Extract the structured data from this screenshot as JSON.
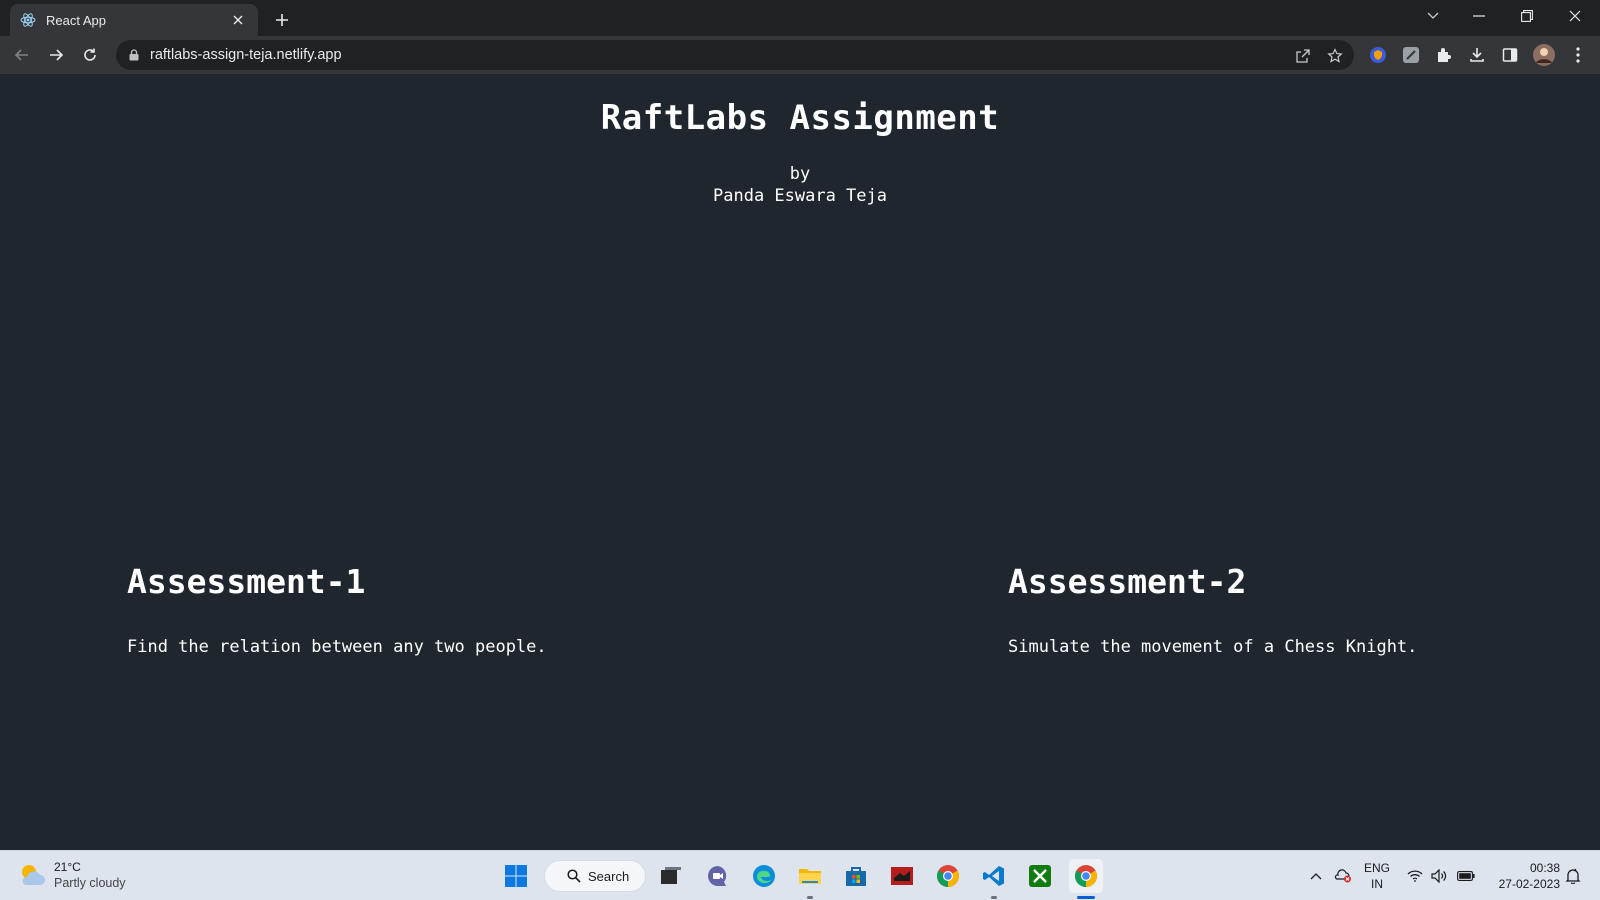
{
  "browser": {
    "tab": {
      "title": "React App",
      "favicon": "react-logo-icon"
    },
    "new_tab_icon": "plus-icon",
    "url": "raftlabs-assign-teja.netlify.app"
  },
  "page": {
    "title": "RaftLabs Assignment",
    "by": "by",
    "author": "Panda Eswara Teja",
    "assessments": [
      {
        "heading": "Assessment-1",
        "description": "Find the relation between any two people."
      },
      {
        "heading": "Assessment-2",
        "description": "Simulate the movement of a Chess Knight."
      }
    ]
  },
  "taskbar": {
    "weather": {
      "temperature": "21°C",
      "condition": "Partly cloudy"
    },
    "search_label": "Search",
    "language": {
      "line1": "ENG",
      "line2": "IN"
    },
    "clock": {
      "time": "00:38",
      "date": "27-02-2023"
    }
  },
  "colors": {
    "page_bg": "#20262e",
    "text": "#ffffff",
    "browser_frame": "#35363a",
    "taskbar_bg": "#dde4ee"
  }
}
